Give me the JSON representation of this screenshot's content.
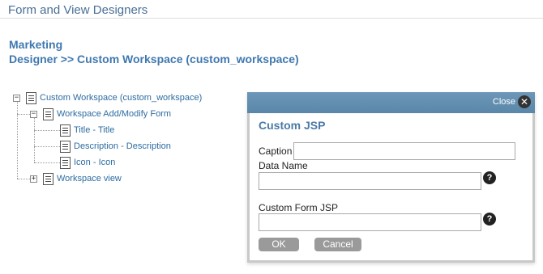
{
  "page": {
    "title": "Form and View Designers",
    "breadcrumb_line1": "Marketing",
    "breadcrumb_line2": "Designer >> Custom Workspace (custom_workspace)"
  },
  "tree": {
    "root": {
      "label": "Custom Workspace (custom_workspace)",
      "toggle": "−"
    },
    "form": {
      "label": "Workspace Add/Modify Form",
      "toggle": "−"
    },
    "items": [
      {
        "label": "Title - Title"
      },
      {
        "label": "Description - Description"
      },
      {
        "label": "Icon - Icon"
      }
    ],
    "view": {
      "label": "Workspace view",
      "toggle": "+"
    }
  },
  "dialog": {
    "close_label": "Close",
    "close_glyph": "✕",
    "title": "Custom JSP",
    "caption_label": "Caption",
    "caption_value": "",
    "data_name_label": "Data Name",
    "data_name_value": "",
    "custom_form_label": "Custom Form JSP",
    "custom_form_value": "",
    "help_glyph": "?",
    "ok_label": "OK",
    "cancel_label": "Cancel"
  },
  "colors": {
    "accent": "#3f78b0",
    "dialog_bar": "#5a86a9",
    "button": "#9a9a9a"
  }
}
